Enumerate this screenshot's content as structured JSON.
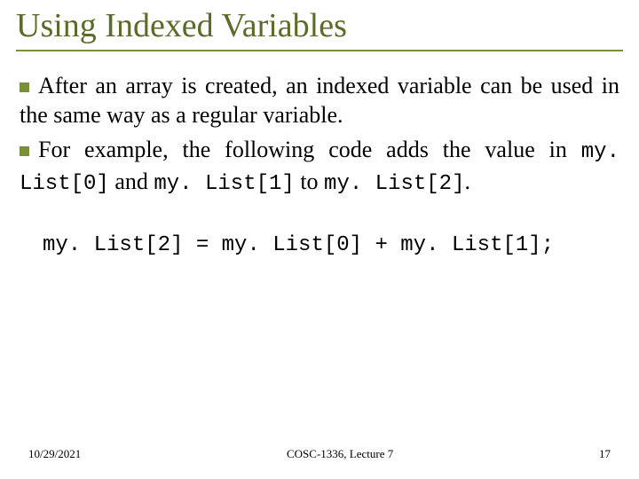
{
  "title": "Using Indexed Variables",
  "para1": {
    "pre": "After an array is created, an indexed variable can be used in the same way as a regular variable."
  },
  "para2": {
    "pre": "For example, the following code adds the value in ",
    "c1": "my. List[0]",
    "mid1": " and ",
    "c2": "my. List[1]",
    "mid2": " to ",
    "c3": "my. List[2]",
    "end": "."
  },
  "code": "my. List[2] = my. List[0] + my. List[1];",
  "footer": {
    "date": "10/29/2021",
    "center": "COSC-1336, Lecture 7",
    "page": "17"
  }
}
